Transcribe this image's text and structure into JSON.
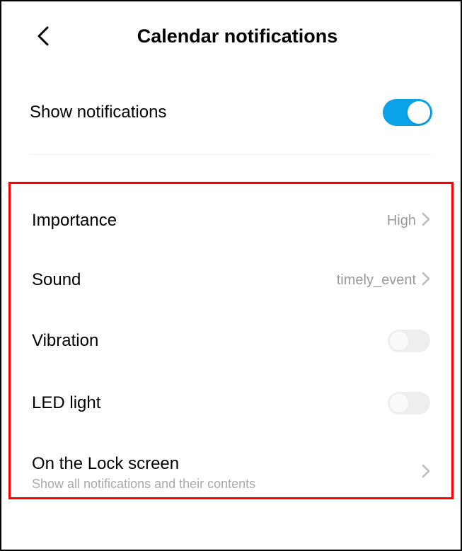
{
  "header": {
    "title": "Calendar notifications"
  },
  "show_notifications": {
    "label": "Show notifications",
    "on": true
  },
  "settings": {
    "importance": {
      "label": "Importance",
      "value": "High"
    },
    "sound": {
      "label": "Sound",
      "value": "timely_event"
    },
    "vibration": {
      "label": "Vibration",
      "on": false
    },
    "led_light": {
      "label": "LED light",
      "on": false
    },
    "lock_screen": {
      "label": "On the Lock screen",
      "sub": "Show all notifications and their contents"
    }
  }
}
